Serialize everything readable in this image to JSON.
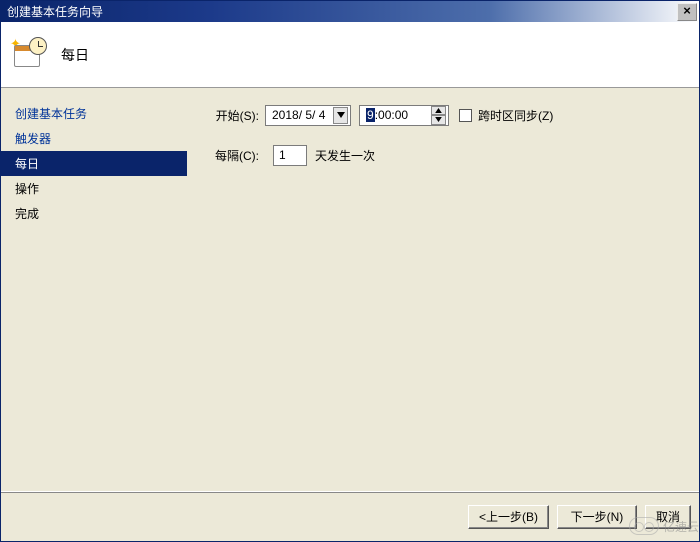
{
  "window": {
    "title": "创建基本任务向导",
    "close_glyph": "×"
  },
  "header": {
    "title": "每日"
  },
  "sidebar": {
    "items": [
      {
        "label": "创建基本任务",
        "kind": "link"
      },
      {
        "label": "触发器",
        "kind": "link"
      },
      {
        "label": "每日",
        "kind": "selected"
      },
      {
        "label": "操作",
        "kind": "plain"
      },
      {
        "label": "完成",
        "kind": "plain"
      }
    ]
  },
  "form": {
    "start_label": "开始(S):",
    "date_value": "2018/ 5/ 4",
    "time_hour": "9",
    "time_rest": ":00:00",
    "tz_sync_label": "跨时区同步(Z)",
    "tz_sync_checked": false,
    "interval_label": "每隔(C):",
    "interval_value": "1",
    "interval_suffix": "天发生一次"
  },
  "buttons": {
    "back": "<上一步(B)",
    "next": "下一步(N)",
    "cancel": "取消"
  },
  "watermark": "亿速云"
}
